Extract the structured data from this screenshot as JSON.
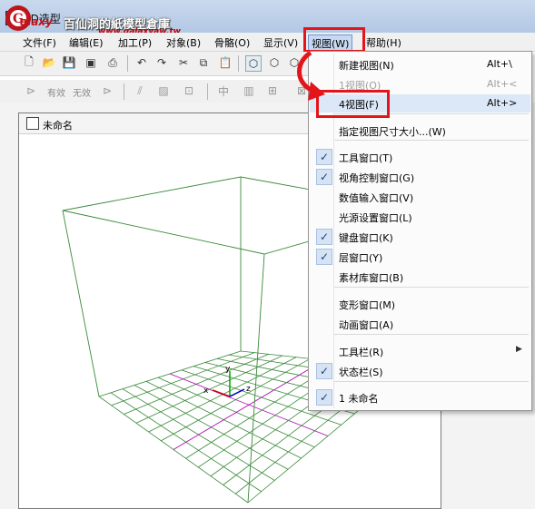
{
  "window": {
    "title": "3D造型",
    "app_icon": "app-icon"
  },
  "watermark": {
    "text": "百仙洞的紙模型倉庫",
    "url": "www.galaxyaw.tw",
    "logo_text": "Galaxy"
  },
  "menubar": {
    "items": [
      {
        "label": "文件(F)"
      },
      {
        "label": "编辑(E)"
      },
      {
        "label": "加工(P)"
      },
      {
        "label": "对象(B)"
      },
      {
        "label": "骨骼(O)"
      },
      {
        "label": "显示(V)"
      },
      {
        "label": "视图(W)"
      },
      {
        "label": "帮助(H)"
      }
    ]
  },
  "toolbar2": {
    "enable_label": "有效",
    "disable_label": "无效"
  },
  "document": {
    "title": "未命名"
  },
  "view_menu": {
    "items": [
      {
        "label": "新建视图(N)",
        "shortcut": "Alt+\\",
        "checked": false,
        "disabled": false
      },
      {
        "label": "1视图(O)",
        "shortcut": "Alt+<",
        "checked": false,
        "disabled": true
      },
      {
        "label": "4视图(F)",
        "shortcut": "Alt+>",
        "checked": false,
        "disabled": false
      },
      {
        "label": "指定视图尺寸大小...(W)",
        "shortcut": "",
        "checked": false,
        "disabled": false
      },
      {
        "label": "工具窗口(T)",
        "shortcut": "",
        "checked": true,
        "disabled": false
      },
      {
        "label": "视角控制窗口(G)",
        "shortcut": "",
        "checked": true,
        "disabled": false
      },
      {
        "label": "数值输入窗口(V)",
        "shortcut": "",
        "checked": false,
        "disabled": false
      },
      {
        "label": "光源设置窗口(L)",
        "shortcut": "",
        "checked": false,
        "disabled": false
      },
      {
        "label": "键盘窗口(K)",
        "shortcut": "",
        "checked": true,
        "disabled": false
      },
      {
        "label": "层窗口(Y)",
        "shortcut": "",
        "checked": true,
        "disabled": false
      },
      {
        "label": "素材库窗口(B)",
        "shortcut": "",
        "checked": false,
        "disabled": false
      },
      {
        "label": "变形窗口(M)",
        "shortcut": "",
        "checked": false,
        "disabled": false
      },
      {
        "label": "动画窗口(A)",
        "shortcut": "",
        "checked": false,
        "disabled": false
      },
      {
        "label": "工具栏(R)",
        "shortcut": "",
        "checked": false,
        "disabled": false,
        "submenu": true
      },
      {
        "label": "状态栏(S)",
        "shortcut": "",
        "checked": true,
        "disabled": false
      },
      {
        "label": "1 未命名",
        "shortcut": "",
        "checked": true,
        "disabled": false
      }
    ]
  },
  "axes": {
    "x": "x",
    "y": "y",
    "z": "z"
  },
  "colors": {
    "highlight": "#e3151a",
    "grid": "#3a8a3a",
    "axis_x": "#d00000",
    "axis_y": "#00a000",
    "axis_z": "#0000c0",
    "grid_center": "#b000b0"
  }
}
